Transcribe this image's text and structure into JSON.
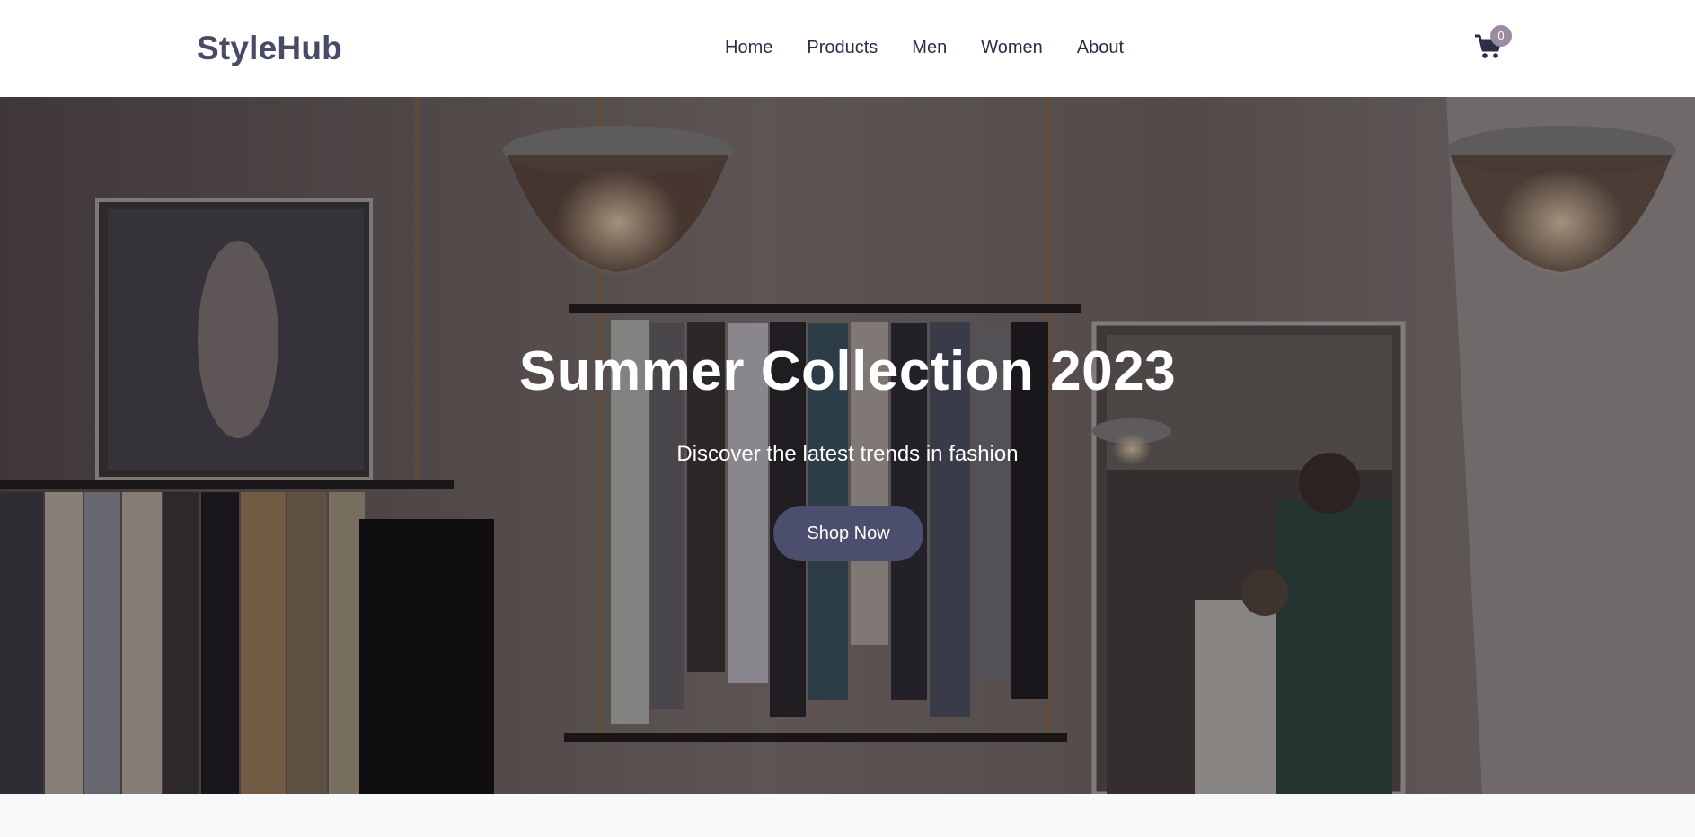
{
  "header": {
    "logo": "StyleHub",
    "nav": [
      "Home",
      "Products",
      "Men",
      "Women",
      "About"
    ],
    "cart_icon": "shopping-cart-icon",
    "cart_count": "0"
  },
  "hero": {
    "title": "Summer Collection 2023",
    "subtitle": "Discover the latest trends in fashion",
    "cta_label": "Shop Now"
  },
  "colors": {
    "brand": "#474b66",
    "button": "#4b4e6d",
    "badge": "#9b8aa3",
    "section_bg": "#f7f8fa"
  }
}
